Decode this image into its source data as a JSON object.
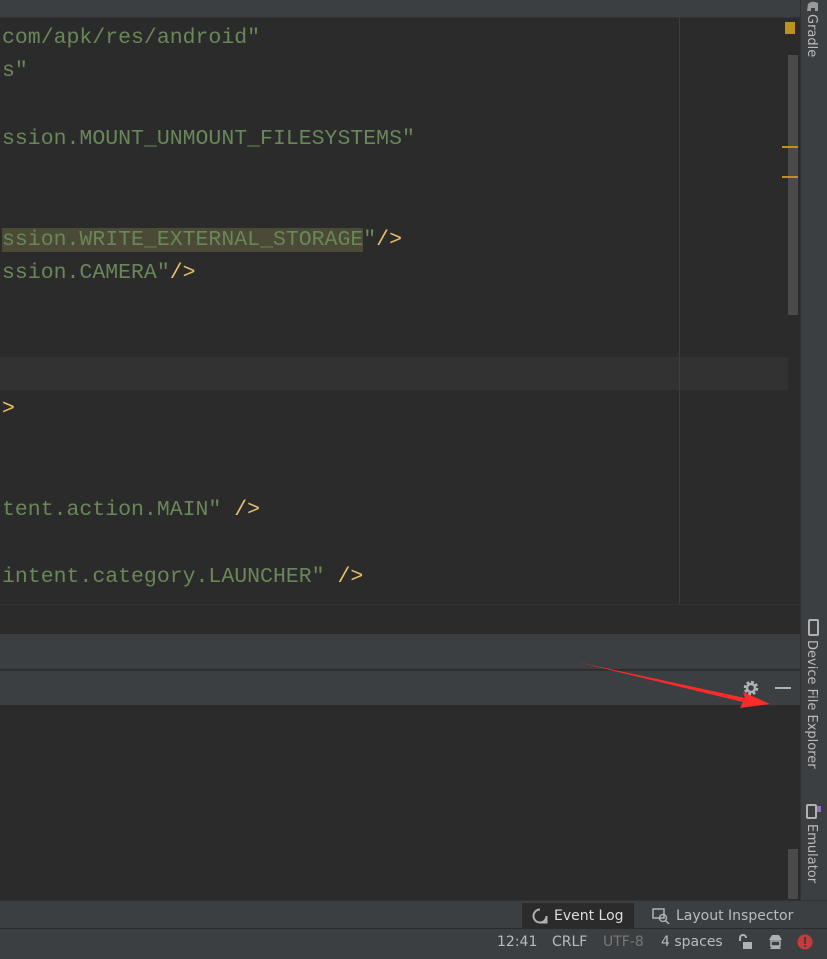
{
  "editor": {
    "lines": [
      "com/apk/res/android\"",
      "s\"",
      "ssion.MOUNT_UNMOUNT_FILESYSTEMS\"",
      "ssion.WRITE_EXTERNAL_STORAGE",
      "ssion.CAMERA\"",
      ">",
      "tent.action.MAIN\" ",
      "intent.category.LAUNCHER\" "
    ],
    "close_quote": "\"",
    "self_close": "/>"
  },
  "right_strip": {
    "gradle": "Gradle",
    "device_file_explorer": "Device File Explorer",
    "emulator": "Emulator"
  },
  "tool_windows": {
    "event_log": "Event Log",
    "layout_inspector": "Layout Inspector"
  },
  "status_bar": {
    "position": "12:41",
    "line_separator": "CRLF",
    "encoding": "UTF-8",
    "indent": "4 spaces"
  },
  "colors": {
    "annotation_arrow": "#ff2a2a",
    "string": "#6a8759",
    "tag": "#e8bf6a",
    "error": "#c93b3b"
  }
}
